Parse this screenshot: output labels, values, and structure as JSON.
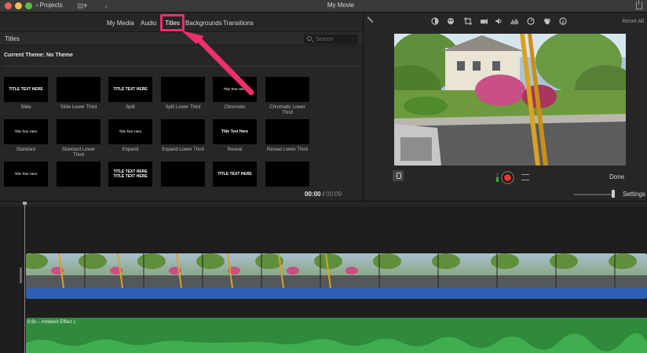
{
  "titlebar": {
    "projects_label": "Projects",
    "window_title": "My Movie"
  },
  "browser": {
    "tabs": [
      {
        "label": "My Media"
      },
      {
        "label": "Audio"
      },
      {
        "label": "Titles",
        "active": true
      },
      {
        "label": "Backgrounds"
      },
      {
        "label": "Transitions"
      }
    ],
    "panel_title": "Titles",
    "search_placeholder": "Search",
    "current_theme": "Current Theme: No Theme",
    "highlight_color": "#ee2f6b",
    "titles": [
      {
        "thumb_text": "TITLE TEXT HERE",
        "caption": "Slide"
      },
      {
        "thumb_text": "",
        "caption": "Slide Lower Third"
      },
      {
        "thumb_text": "TITLE TEXT HERE",
        "caption": "Split"
      },
      {
        "thumb_text": "",
        "caption": "Split Lower Third"
      },
      {
        "thumb_text": "Title Text Here",
        "caption": "Chromatic"
      },
      {
        "thumb_text": "",
        "caption": "Chromatic Lower Third"
      },
      {
        "thumb_text": "Title Text Here",
        "caption": "Standard"
      },
      {
        "thumb_text": "",
        "caption": "Standard Lower Third"
      },
      {
        "thumb_text": "Title Text Here",
        "caption": "Expand"
      },
      {
        "thumb_text": "",
        "caption": "Expand Lower Third"
      },
      {
        "thumb_text": "Title Text Here",
        "caption": "Reveal"
      },
      {
        "thumb_text": "",
        "caption": "Reveal Lower Third"
      },
      {
        "thumb_text": "Title Text Here",
        "caption": ""
      },
      {
        "thumb_text": "",
        "caption": ""
      },
      {
        "thumb_text": "TITLE TEXT HERE TITLE TEXT HERE",
        "caption": ""
      },
      {
        "thumb_text": "",
        "caption": ""
      },
      {
        "thumb_text": "TITLE TEXT HERE",
        "caption": ""
      },
      {
        "thumb_text": "",
        "caption": ""
      }
    ],
    "timecode_current": "00:00",
    "timecode_separator": "/",
    "timecode_total": "00:09"
  },
  "viewer": {
    "toolbar_icons": [
      "color-balance-icon",
      "color-correction-icon",
      "crop-icon",
      "stabilization-icon",
      "volume-icon",
      "noise-reduction-icon",
      "speed-icon",
      "clip-filter-icon",
      "info-icon"
    ],
    "reset_all_label": "Reset All",
    "done_label": "Done",
    "settings_label": "Settings",
    "record_color": "#e8362b"
  },
  "timeline": {
    "audio_clip_label": "8.9s – Ambient Effect 1",
    "video_track_color": "#2f5fb0",
    "audio_track_color": "#2f8a3c"
  }
}
